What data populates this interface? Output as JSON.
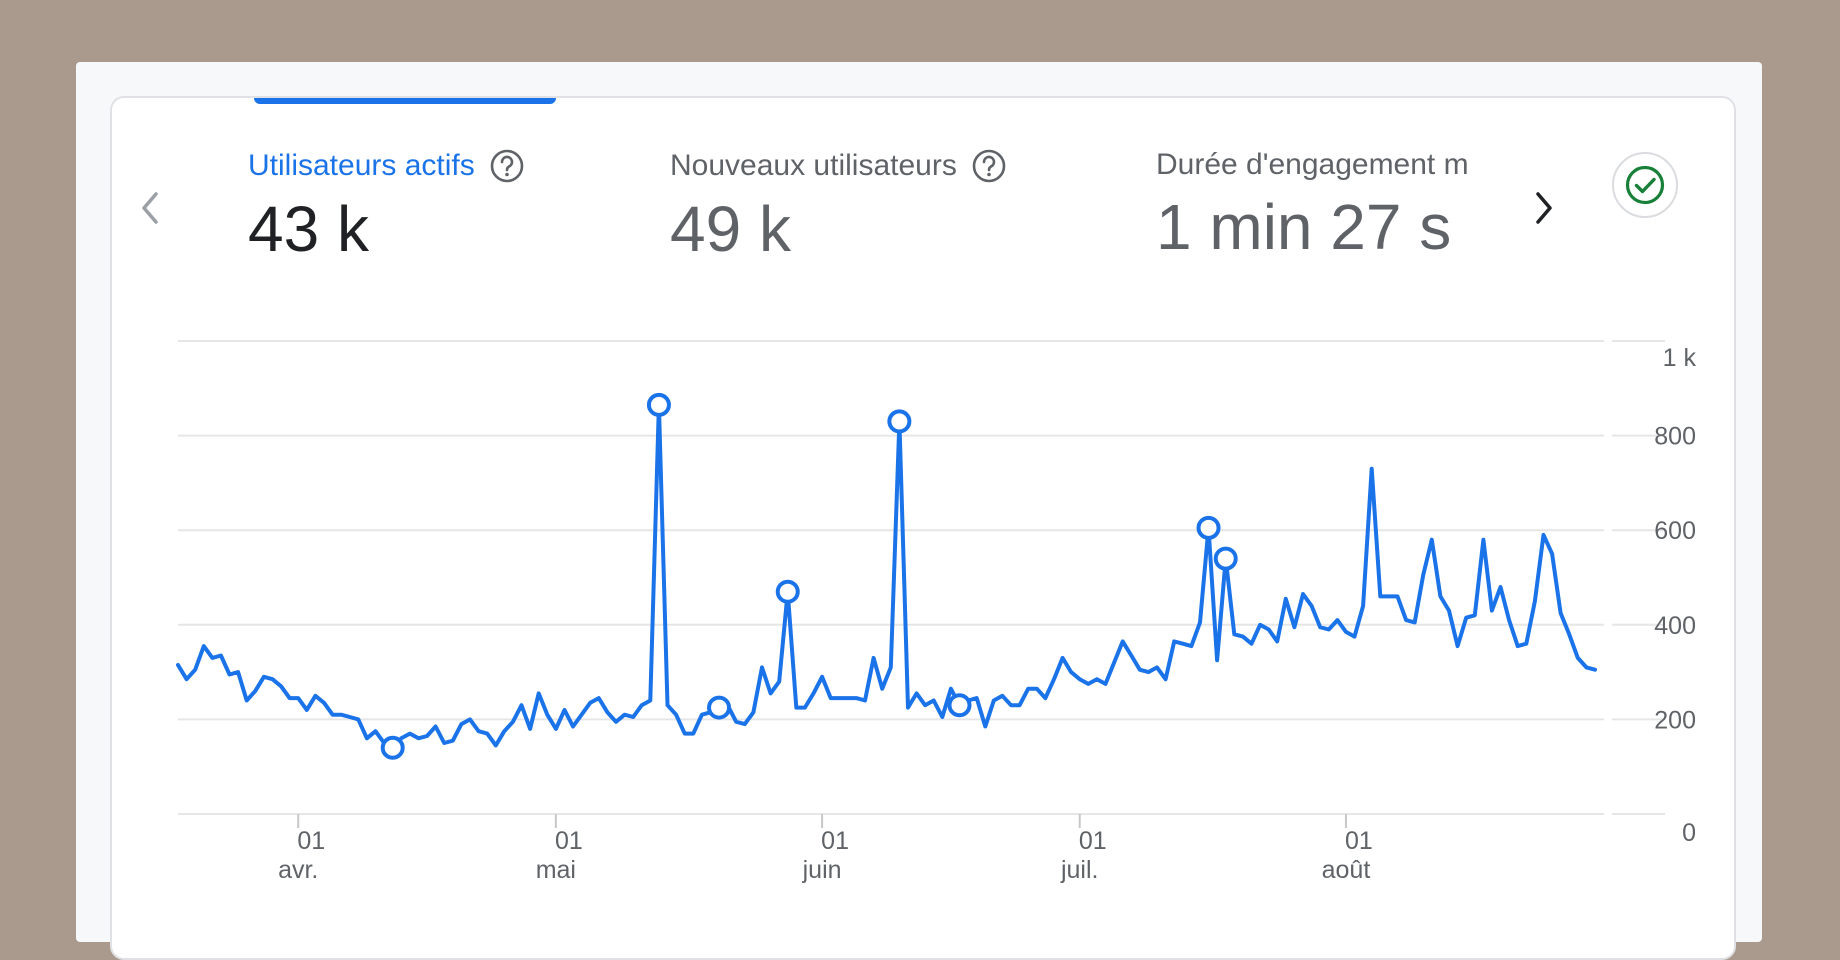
{
  "metrics": [
    {
      "label": "Utilisateurs actifs",
      "value": "43 k",
      "active": true,
      "help_icon": "help-circle-icon"
    },
    {
      "label": "Nouveaux utilisateurs",
      "value": "49 k",
      "active": false,
      "help_icon": "help-circle-icon"
    },
    {
      "label": "Durée d'engagement m",
      "value": "1 min 27 s",
      "active": false
    }
  ],
  "nav": {
    "prev_icon": "chevron-left-icon",
    "next_icon": "chevron-right-icon"
  },
  "status_icon": "check-circle-icon",
  "colors": {
    "accent": "#1a73e8",
    "status_green": "#188038",
    "grid": "#e6e6e6",
    "text_muted": "#5f6368"
  },
  "chart_data": {
    "type": "line",
    "title": "",
    "xlabel": "",
    "ylabel": "",
    "ylim": [
      0,
      1000
    ],
    "yticks": [
      {
        "value": 0,
        "label": "0"
      },
      {
        "value": 200,
        "label": "200"
      },
      {
        "value": 400,
        "label": "400"
      },
      {
        "value": 600,
        "label": "600"
      },
      {
        "value": 800,
        "label": "800"
      },
      {
        "value": 1000,
        "label": "1 k"
      }
    ],
    "x_start": "2025-03-18",
    "x_end": "2025-08-30",
    "xticks": [
      {
        "date": "2025-04-01",
        "day": "01",
        "month": "avr."
      },
      {
        "date": "2025-05-01",
        "day": "01",
        "month": "mai"
      },
      {
        "date": "2025-06-01",
        "day": "01",
        "month": "juin"
      },
      {
        "date": "2025-07-01",
        "day": "01",
        "month": "juil."
      },
      {
        "date": "2025-08-01",
        "day": "01",
        "month": "août"
      }
    ],
    "grid": true,
    "series": [
      {
        "color": "#1a73e8",
        "points": [
          [
            "2025-03-18",
            315
          ],
          [
            "2025-03-19",
            285
          ],
          [
            "2025-03-20",
            305
          ],
          [
            "2025-03-21",
            355
          ],
          [
            "2025-03-22",
            330
          ],
          [
            "2025-03-23",
            335
          ],
          [
            "2025-03-24",
            295
          ],
          [
            "2025-03-25",
            300
          ],
          [
            "2025-03-26",
            240
          ],
          [
            "2025-03-27",
            260
          ],
          [
            "2025-03-28",
            290
          ],
          [
            "2025-03-29",
            285
          ],
          [
            "2025-03-30",
            270
          ],
          [
            "2025-03-31",
            245
          ],
          [
            "2025-04-01",
            245
          ],
          [
            "2025-04-02",
            220
          ],
          [
            "2025-04-03",
            250
          ],
          [
            "2025-04-04",
            235
          ],
          [
            "2025-04-05",
            210
          ],
          [
            "2025-04-06",
            210
          ],
          [
            "2025-04-07",
            205
          ],
          [
            "2025-04-08",
            200
          ],
          [
            "2025-04-09",
            160
          ],
          [
            "2025-04-10",
            175
          ],
          [
            "2025-04-11",
            150
          ],
          [
            "2025-04-12",
            140
          ],
          [
            "2025-04-13",
            160
          ],
          [
            "2025-04-14",
            170
          ],
          [
            "2025-04-15",
            160
          ],
          [
            "2025-04-16",
            165
          ],
          [
            "2025-04-17",
            185
          ],
          [
            "2025-04-18",
            150
          ],
          [
            "2025-04-19",
            155
          ],
          [
            "2025-04-20",
            190
          ],
          [
            "2025-04-21",
            200
          ],
          [
            "2025-04-22",
            175
          ],
          [
            "2025-04-23",
            170
          ],
          [
            "2025-04-24",
            145
          ],
          [
            "2025-04-25",
            175
          ],
          [
            "2025-04-26",
            195
          ],
          [
            "2025-04-27",
            230
          ],
          [
            "2025-04-28",
            180
          ],
          [
            "2025-04-29",
            255
          ],
          [
            "2025-04-30",
            210
          ],
          [
            "2025-05-01",
            180
          ],
          [
            "2025-05-02",
            220
          ],
          [
            "2025-05-03",
            185
          ],
          [
            "2025-05-04",
            210
          ],
          [
            "2025-05-05",
            235
          ],
          [
            "2025-05-06",
            245
          ],
          [
            "2025-05-07",
            215
          ],
          [
            "2025-05-08",
            195
          ],
          [
            "2025-05-09",
            210
          ],
          [
            "2025-05-10",
            205
          ],
          [
            "2025-05-11",
            230
          ],
          [
            "2025-05-12",
            240
          ],
          [
            "2025-05-13",
            865
          ],
          [
            "2025-05-14",
            230
          ],
          [
            "2025-05-15",
            210
          ],
          [
            "2025-05-16",
            170
          ],
          [
            "2025-05-17",
            170
          ],
          [
            "2025-05-18",
            210
          ],
          [
            "2025-05-19",
            215
          ],
          [
            "2025-05-20",
            225
          ],
          [
            "2025-05-21",
            230
          ],
          [
            "2025-05-22",
            195
          ],
          [
            "2025-05-23",
            190
          ],
          [
            "2025-05-24",
            215
          ],
          [
            "2025-05-25",
            310
          ],
          [
            "2025-05-26",
            255
          ],
          [
            "2025-05-27",
            280
          ],
          [
            "2025-05-28",
            470
          ],
          [
            "2025-05-29",
            225
          ],
          [
            "2025-05-30",
            225
          ],
          [
            "2025-05-31",
            255
          ],
          [
            "2025-06-01",
            290
          ],
          [
            "2025-06-02",
            245
          ],
          [
            "2025-06-03",
            245
          ],
          [
            "2025-06-04",
            245
          ],
          [
            "2025-06-05",
            245
          ],
          [
            "2025-06-06",
            240
          ],
          [
            "2025-06-07",
            330
          ],
          [
            "2025-06-08",
            265
          ],
          [
            "2025-06-09",
            310
          ],
          [
            "2025-06-10",
            830
          ],
          [
            "2025-06-11",
            225
          ],
          [
            "2025-06-12",
            255
          ],
          [
            "2025-06-13",
            230
          ],
          [
            "2025-06-14",
            240
          ],
          [
            "2025-06-15",
            205
          ],
          [
            "2025-06-16",
            265
          ],
          [
            "2025-06-17",
            230
          ],
          [
            "2025-06-18",
            240
          ],
          [
            "2025-06-19",
            245
          ],
          [
            "2025-06-20",
            185
          ],
          [
            "2025-06-21",
            240
          ],
          [
            "2025-06-22",
            250
          ],
          [
            "2025-06-23",
            230
          ],
          [
            "2025-06-24",
            230
          ],
          [
            "2025-06-25",
            265
          ],
          [
            "2025-06-26",
            265
          ],
          [
            "2025-06-27",
            245
          ],
          [
            "2025-06-28",
            285
          ],
          [
            "2025-06-29",
            330
          ],
          [
            "2025-06-30",
            300
          ],
          [
            "2025-07-01",
            285
          ],
          [
            "2025-07-02",
            275
          ],
          [
            "2025-07-03",
            285
          ],
          [
            "2025-07-04",
            275
          ],
          [
            "2025-07-05",
            320
          ],
          [
            "2025-07-06",
            365
          ],
          [
            "2025-07-07",
            335
          ],
          [
            "2025-07-08",
            305
          ],
          [
            "2025-07-09",
            300
          ],
          [
            "2025-07-10",
            310
          ],
          [
            "2025-07-11",
            285
          ],
          [
            "2025-07-12",
            365
          ],
          [
            "2025-07-13",
            360
          ],
          [
            "2025-07-14",
            355
          ],
          [
            "2025-07-15",
            405
          ],
          [
            "2025-07-16",
            605
          ],
          [
            "2025-07-17",
            325
          ],
          [
            "2025-07-18",
            540
          ],
          [
            "2025-07-19",
            380
          ],
          [
            "2025-07-20",
            375
          ],
          [
            "2025-07-21",
            360
          ],
          [
            "2025-07-22",
            400
          ],
          [
            "2025-07-23",
            390
          ],
          [
            "2025-07-24",
            365
          ],
          [
            "2025-07-25",
            455
          ],
          [
            "2025-07-26",
            395
          ],
          [
            "2025-07-27",
            465
          ],
          [
            "2025-07-28",
            440
          ],
          [
            "2025-07-29",
            395
          ],
          [
            "2025-07-30",
            390
          ],
          [
            "2025-07-31",
            410
          ],
          [
            "2025-08-01",
            385
          ],
          [
            "2025-08-02",
            375
          ],
          [
            "2025-08-03",
            440
          ],
          [
            "2025-08-04",
            730
          ],
          [
            "2025-08-05",
            460
          ],
          [
            "2025-08-06",
            460
          ],
          [
            "2025-08-07",
            460
          ],
          [
            "2025-08-08",
            410
          ],
          [
            "2025-08-09",
            405
          ],
          [
            "2025-08-10",
            505
          ],
          [
            "2025-08-11",
            580
          ],
          [
            "2025-08-12",
            460
          ],
          [
            "2025-08-13",
            430
          ],
          [
            "2025-08-14",
            355
          ],
          [
            "2025-08-15",
            415
          ],
          [
            "2025-08-16",
            420
          ],
          [
            "2025-08-17",
            580
          ],
          [
            "2025-08-18",
            430
          ],
          [
            "2025-08-19",
            480
          ],
          [
            "2025-08-20",
            410
          ],
          [
            "2025-08-21",
            355
          ],
          [
            "2025-08-22",
            360
          ],
          [
            "2025-08-23",
            450
          ],
          [
            "2025-08-24",
            590
          ],
          [
            "2025-08-25",
            550
          ],
          [
            "2025-08-26",
            425
          ],
          [
            "2025-08-27",
            380
          ],
          [
            "2025-08-28",
            330
          ],
          [
            "2025-08-29",
            310
          ],
          [
            "2025-08-30",
            305
          ]
        ]
      }
    ],
    "markers": [
      "2025-04-12",
      "2025-05-13",
      "2025-05-20",
      "2025-05-28",
      "2025-06-10",
      "2025-06-17",
      "2025-07-16",
      "2025-07-18"
    ]
  }
}
